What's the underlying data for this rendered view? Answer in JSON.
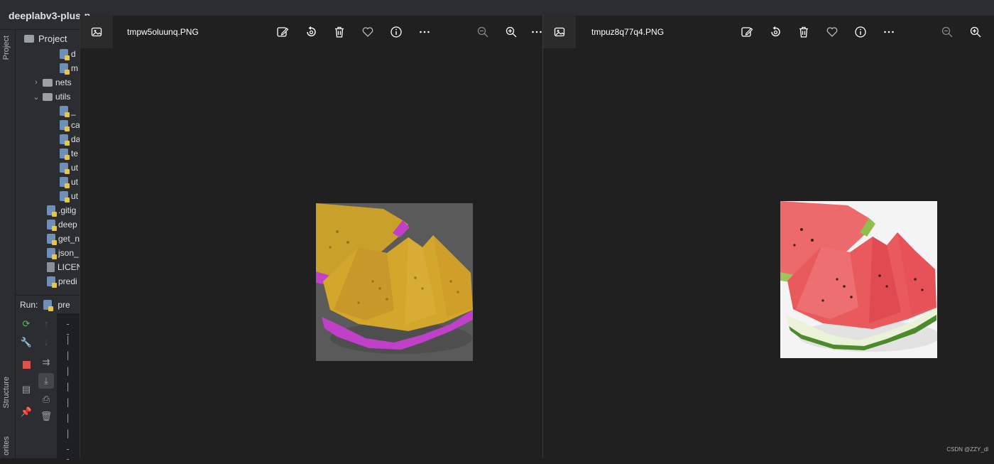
{
  "ide": {
    "project_title": "deeplabv3-plus-p",
    "side_tabs": {
      "project": "Project",
      "structure": "Structure",
      "favorites": "orites"
    },
    "panel_header": "Project",
    "tree": [
      {
        "label": "d",
        "type": "py",
        "level": 2
      },
      {
        "label": "m",
        "type": "py",
        "level": 2
      },
      {
        "label": "nets",
        "type": "folder",
        "level": 1,
        "chevron": "›"
      },
      {
        "label": "utils",
        "type": "folder",
        "level": 1,
        "chevron": "⌄"
      },
      {
        "label": "_",
        "type": "py",
        "level": 2
      },
      {
        "label": "ca",
        "type": "py",
        "level": 2
      },
      {
        "label": "da",
        "type": "py",
        "level": 2
      },
      {
        "label": "te",
        "type": "py",
        "level": 2
      },
      {
        "label": "ut",
        "type": "py",
        "level": 2
      },
      {
        "label": "ut",
        "type": "py",
        "level": 2
      },
      {
        "label": "ut",
        "type": "py",
        "level": 2
      },
      {
        "label": ".gitig",
        "type": "py",
        "level": 0
      },
      {
        "label": "deep",
        "type": "py",
        "level": 0
      },
      {
        "label": "get_n",
        "type": "py",
        "level": 0
      },
      {
        "label": "json_",
        "type": "py",
        "level": 0
      },
      {
        "label": "LICEN",
        "type": "plain",
        "level": 0
      },
      {
        "label": "predi",
        "type": "py",
        "level": 0
      }
    ],
    "run_label": "Run:",
    "run_tab": "pre",
    "console_lines": [
      "- -",
      "|",
      "|",
      "|",
      "|",
      "|",
      "|",
      "|",
      "- -"
    ]
  },
  "viewers": [
    {
      "filename": "tmpw5oluunq.PNG",
      "image": "watermelon-segmented"
    },
    {
      "filename": "tmpuz8q77q4.PNG",
      "image": "watermelon-original"
    }
  ],
  "toolbar_icons": [
    "edit-icon",
    "rotate-icon",
    "delete-icon",
    "favorite-icon",
    "info-icon",
    "more-icon",
    "zoom-out-icon",
    "zoom-in-icon"
  ],
  "watermark": "CSDN @ZZY_dl",
  "colors": {
    "viewer_bg": "#202020",
    "ide_bg": "#2b2d30",
    "mask_yellow": "#d4a62a",
    "mask_magenta": "#c040c8",
    "melon_red": "#e8585a"
  }
}
